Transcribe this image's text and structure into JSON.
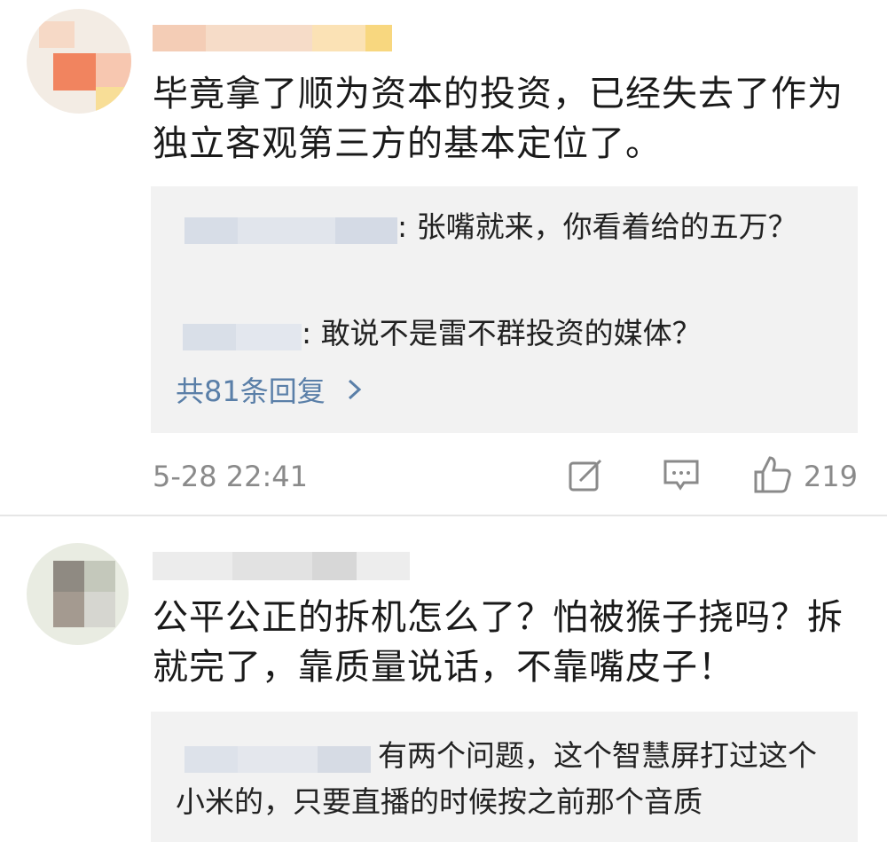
{
  "comments": [
    {
      "text": "毕竟拿了顺为资本的投资，已经失去了作为独立客观第三方的基本定位了。",
      "replies": [
        {
          "text": ": 张嘴就来，你看着给的五万？"
        },
        {
          "text": ": 敢说不是雷不群投资的媒体？"
        }
      ],
      "more_replies": "共81条回复",
      "timestamp": "5-28 22:41",
      "likes": "219",
      "icons": {
        "share": "share-icon",
        "comment": "comment-icon",
        "like": "thumbs-up-icon"
      }
    },
    {
      "text": "公平公正的拆机怎么了？怕被猴子挠吗？拆就完了，靠质量说话，不靠嘴皮子！",
      "replies": [
        {
          "text": "有两个问题，这个智慧屏打过这个小米的，只要直播的时候按之前那个音质"
        }
      ]
    }
  ],
  "colors": {
    "link": "#5a7fa8",
    "meta": "#8a8a8a",
    "reply_bg": "#f2f2f2"
  }
}
